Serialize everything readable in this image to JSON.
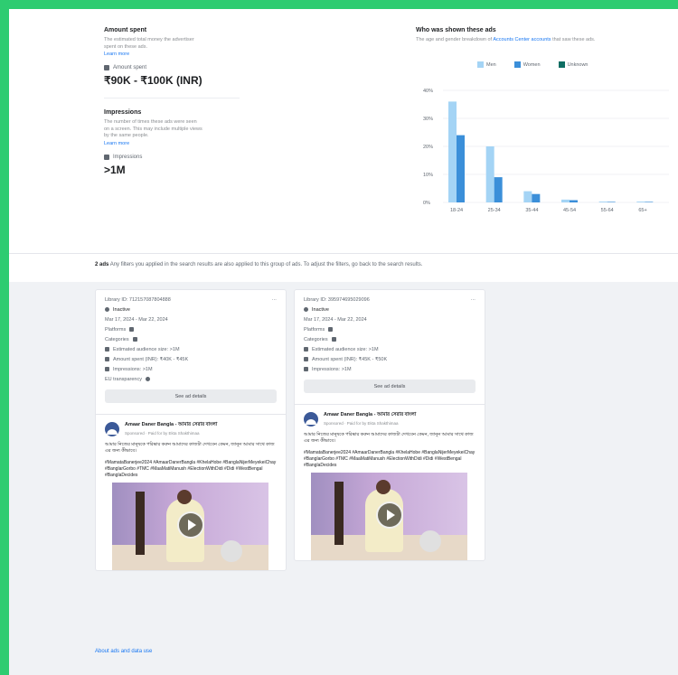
{
  "metrics": {
    "amount_spent": {
      "title": "Amount spent",
      "description": "The estimated total money the advertiser spent on these ads.",
      "learn_more": "Learn more",
      "label": "Amount spent",
      "value": "₹90K - ₹100K (INR)"
    },
    "impressions": {
      "title": "Impressions",
      "description": "The number of times these ads were seen on a screen. This may include multiple views by the same people.",
      "learn_more": "Learn more",
      "label": "Impressions",
      "value": ">1M"
    }
  },
  "chart": {
    "title": "Who was shown these ads",
    "subtitle_prefix": "The age and gender breakdown of",
    "subtitle_link": "Accounts Center accounts",
    "subtitle_suffix": "that saw these ads."
  },
  "chart_data": {
    "type": "bar",
    "categories": [
      "18-24",
      "25-34",
      "35-44",
      "45-54",
      "55-64",
      "65+"
    ],
    "series": [
      {
        "name": "Men",
        "values": [
          36,
          20,
          4,
          1,
          0.3,
          0.3
        ]
      },
      {
        "name": "Women",
        "values": [
          24,
          9,
          3,
          0.8,
          0.2,
          0.2
        ]
      },
      {
        "name": "Unknown",
        "values": [
          0,
          0,
          0,
          0,
          0,
          0
        ]
      }
    ],
    "yticks": [
      "0%",
      "10%",
      "20%",
      "30%",
      "40%"
    ],
    "ylim": [
      0,
      40
    ],
    "colors": {
      "Men": "#a4d4f5",
      "Women": "#3b8fd9",
      "Unknown": "#0e6e63"
    },
    "legend": "top"
  },
  "filter_note": {
    "count": "2 ads",
    "text": "Any filters you applied in the search results are also applied to this group of ads. To adjust the filters, go back to the search results."
  },
  "cards": [
    {
      "library_id": "Library ID: 712157087804888",
      "status": "Inactive",
      "dates": "Mar 17, 2024 - Mar 22, 2024",
      "platforms": "Platforms",
      "categories": "Categories",
      "audience": "Estimated audience size: >1M",
      "spent": "Amount spent (INR): ₹40K - ₹45K",
      "impressions": "Impressions: >1M",
      "eu": "EU transparency",
      "see_details": "See ad details",
      "page_name": "Amaar Daner Bangla - আমার সেরার বাংলা",
      "sponsored": "Sponsored · Paid for by Ekta Shakthimaa",
      "text": "আমার নিজের মানুষকে পরিষ্কার করুন আমাদের কাজটা দেখবেন কেমন, জানুন আমার সাথে কাজ এর জন্য কীভাবে।",
      "tags": "#MamataBanerjee2024 #AmaarDanerBangla #KhelaHobe #BanglaNijerMeyekeiChay #BanglarGorbo #TMC #MaaMatiManush #ElectionWithDidi #Didi #WestBengal #BanglaDecides"
    },
    {
      "library_id": "Library ID: 395974695029096",
      "status": "Inactive",
      "dates": "Mar 17, 2024 - Mar 22, 2024",
      "platforms": "Platforms",
      "categories": "Categories",
      "audience": "Estimated audience size: >1M",
      "spent": "Amount spent (INR): ₹45K - ₹50K",
      "impressions": "Impressions: >1M",
      "see_details": "See ad details",
      "page_name": "Amaar Daner Bangla - আমার সেরার বাংলা",
      "sponsored": "Sponsored · Paid for by Ekta Shakthimaa",
      "text": "আমার নিজের মানুষকে পরিষ্কার করুন আমাদের কাজটা দেখবেন কেমন, জানুন আমার সাথে কাজ এর জন্য কীভাবে।",
      "tags": "#MamataBanerjee2024 #AmaarDanerBangla #KhelaHobe #BanglaNijerMeyekeiChay #BanglarGorbo #TMC #MaaMatiManush #ElectionWithDidi #Didi #WestBengal #BanglaDecides"
    }
  ],
  "footer": {
    "about_link": "About ads and data use"
  }
}
